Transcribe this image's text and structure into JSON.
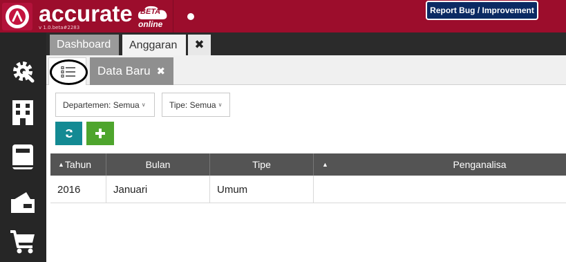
{
  "header": {
    "brand": "accurate",
    "version": "v 1.0.beta#2283",
    "beta_label": "BETA",
    "online_label": "online",
    "report_button": "Report Bug / Improvement",
    "brand_color": "#9c0d2c"
  },
  "sidebar": {
    "icons": [
      "gear-wrench-icon",
      "building-icon",
      "book-icon",
      "wallet-icon",
      "cart-icon"
    ]
  },
  "tabs": {
    "items": [
      {
        "label": "Dashboard",
        "active": false
      },
      {
        "label": "Anggaran",
        "active": true
      }
    ],
    "close_glyph": "✖"
  },
  "subtabs": {
    "data_baru_label": "Data Baru",
    "close_glyph": "✖"
  },
  "filters": {
    "departemen": "Departemen: Semua",
    "tipe": "Tipe: Semua"
  },
  "table": {
    "columns": [
      "Tahun",
      "Bulan",
      "Tipe",
      "",
      "Penganalisa"
    ],
    "rows": [
      {
        "tahun": "2016",
        "bulan": "Januari",
        "tipe": "Umum",
        "penganalisa": ""
      }
    ]
  },
  "colors": {
    "refresh_button": "#138a93",
    "add_button": "#4ea52d",
    "table_header": "#545454"
  }
}
